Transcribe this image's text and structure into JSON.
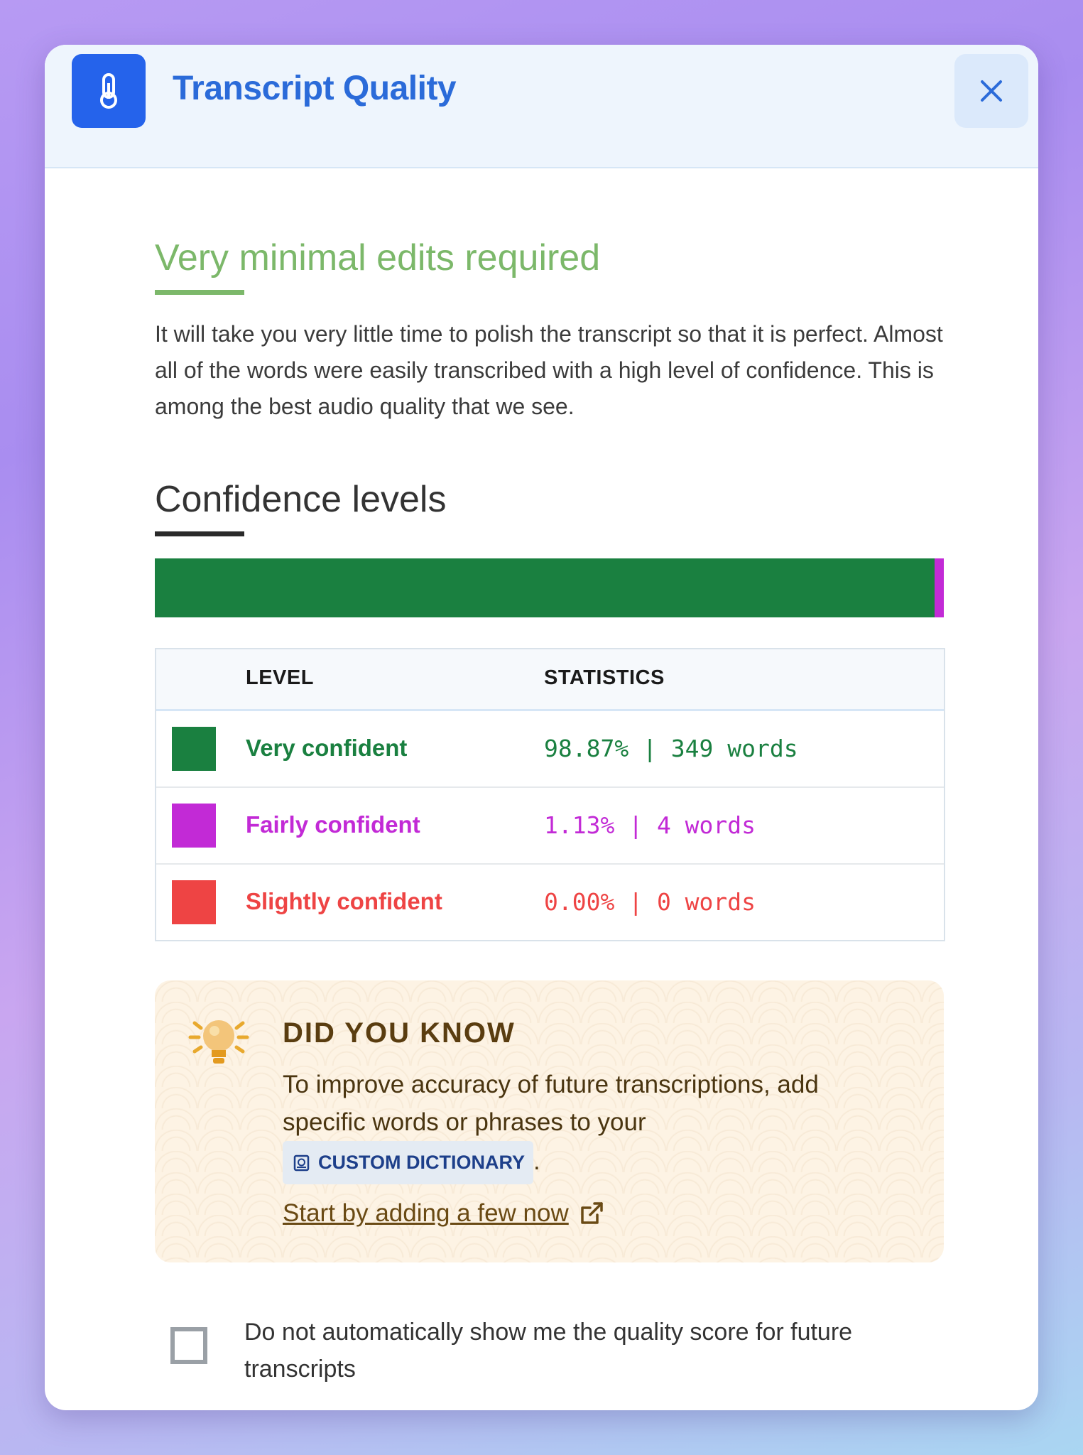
{
  "header": {
    "title": "Transcript Quality",
    "icon": "thermometer-icon",
    "close_icon": "close-icon"
  },
  "quality": {
    "headline": "Very minimal edits required",
    "description": "It will take you very little time to polish the transcript so that it is perfect. Almost all of the words were easily transcribed with a high level of confidence. This is among the best audio quality that we see."
  },
  "confidence": {
    "title": "Confidence levels",
    "bar": [
      {
        "level": "Very confident",
        "percent": 98.87,
        "color": "#1a8040"
      },
      {
        "level": "Fairly confident",
        "percent": 1.13,
        "color": "#c22ad6"
      },
      {
        "level": "Slightly confident",
        "percent": 0.0,
        "color": "#ee4444"
      }
    ],
    "table": {
      "headers": [
        "LEVEL",
        "STATISTICS"
      ],
      "rows": [
        {
          "label": "Very confident",
          "stat": "98.87% | 349 words",
          "color": "#1a8040"
        },
        {
          "label": "Fairly confident",
          "stat": "1.13% | 4 words",
          "color": "#c22ad6"
        },
        {
          "label": "Slightly confident",
          "stat": "0.00% | 0 words",
          "color": "#ee4444"
        }
      ]
    }
  },
  "tip": {
    "icon": "lightbulb-icon",
    "title": "DID YOU KNOW",
    "text": "To improve accuracy of future transcriptions, add specific words or phrases to your",
    "badge": "CUSTOM DICTIONARY",
    "badge_icon": "book-icon",
    "period": ".",
    "link": "Start by adding a few now",
    "link_icon": "external-link-icon"
  },
  "preference": {
    "checkbox_checked": false,
    "label": "Do not automatically show me the quality score for future transcripts"
  }
}
